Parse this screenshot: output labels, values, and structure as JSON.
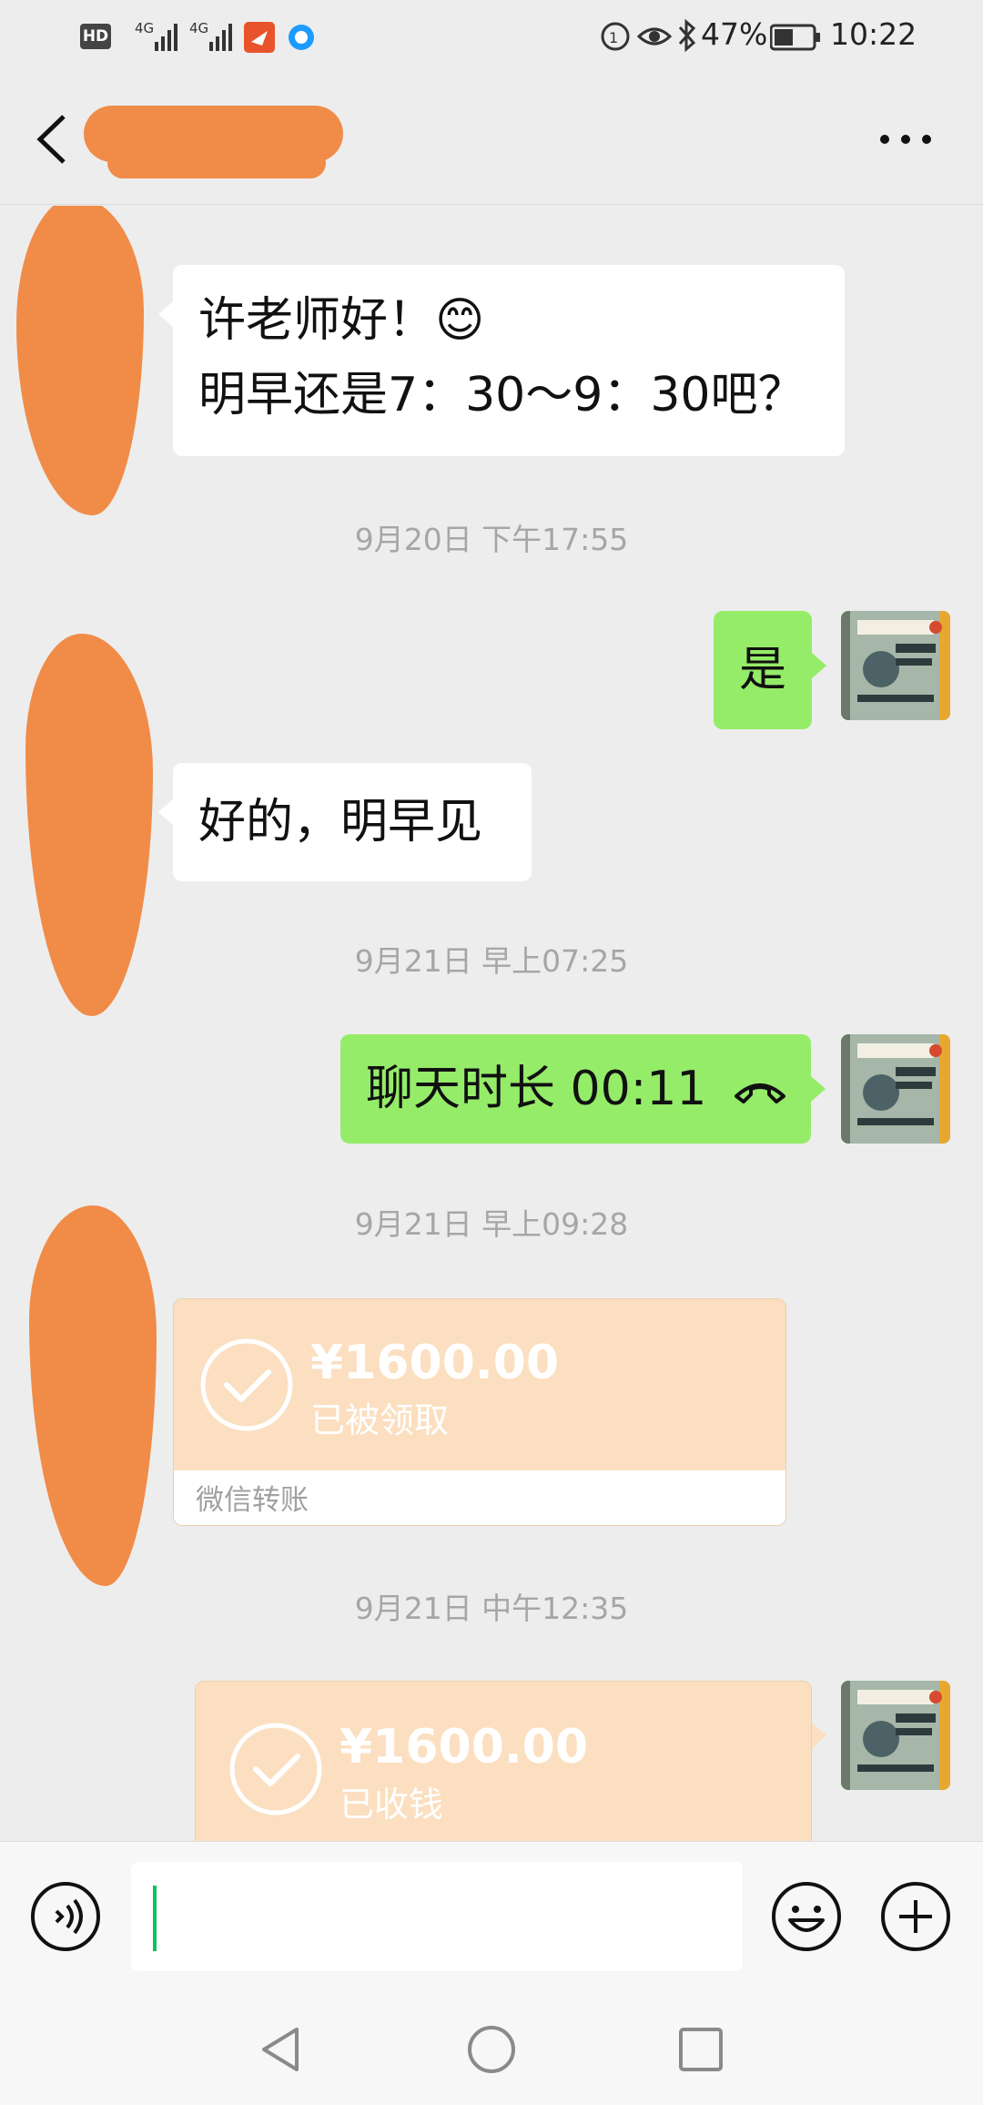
{
  "status_bar": {
    "left_badges": [
      "HD",
      "4G",
      "4G"
    ],
    "battery": "47%",
    "time": "10:22"
  },
  "header": {
    "back_icon": "chevron-left-icon",
    "more_icon": "more-icon"
  },
  "messages": [
    {
      "sender": "other",
      "lines": [
        "许老师好！😊",
        "明早还是7：30～9：30吧？"
      ]
    },
    {
      "type": "timestamp",
      "text": "9月20日 下午17:55"
    },
    {
      "sender": "self",
      "text": "是"
    },
    {
      "sender": "other",
      "text": "好的，明早见"
    },
    {
      "type": "timestamp",
      "text": "9月21日 早上07:25"
    },
    {
      "sender": "self",
      "text": "聊天时长 00:11",
      "icon": "phone-hangup-icon"
    },
    {
      "type": "timestamp",
      "text": "9月21日 早上09:28"
    },
    {
      "sender": "other",
      "type": "transfer",
      "amount": "¥1600.00",
      "status": "已被领取",
      "footer": "微信转账"
    },
    {
      "type": "timestamp",
      "text": "9月21日 中午12:35"
    },
    {
      "sender": "self",
      "type": "transfer",
      "amount": "¥1600.00",
      "status": "已收钱"
    }
  ],
  "input_bar": {
    "voice_icon": "voice-icon",
    "emoji_icon": "emoji-icon",
    "plus_icon": "plus-icon",
    "text_value": ""
  },
  "colors": {
    "outgoing_bubble": "#95ec69",
    "incoming_bubble": "#ffffff",
    "transfer_card": "#fbdfc0",
    "background": "#ededed",
    "cursor": "#07c160"
  }
}
